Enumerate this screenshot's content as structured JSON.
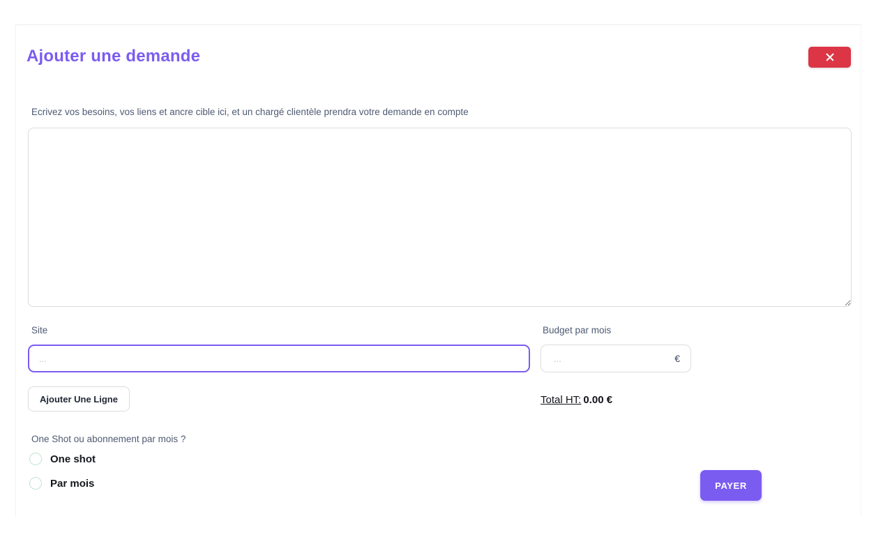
{
  "modal": {
    "title": "Ajouter une demande",
    "close_label": "×",
    "close_icon": "close-x-icon"
  },
  "form": {
    "helper_text": "Ecrivez vos besoins, vos liens et ancre cible ici, et un chargé clientèle prendra votre demande en compte",
    "needs_textarea": {
      "value": "",
      "placeholder": ""
    },
    "site": {
      "label": "Site",
      "value": "",
      "placeholder": "..."
    },
    "budget": {
      "label": "Budget par mois",
      "value": "",
      "placeholder": "...",
      "currency": "€"
    },
    "add_line_label": "Ajouter Une Ligne",
    "total": {
      "label": "Total HT:",
      "value": "0.00 €"
    },
    "subscription": {
      "question": "One Shot ou abonnement par mois ?",
      "options": [
        {
          "label": "One shot",
          "selected": false
        },
        {
          "label": "Par mois",
          "selected": false
        }
      ]
    },
    "pay_label": "PAYER"
  },
  "colors": {
    "accent_purple": "#7b5cf0",
    "danger_red": "#dc3545",
    "radio_outline_green": "#bfe6cd",
    "label_slate": "#4e5a72",
    "border_gray": "#dcdce1"
  }
}
